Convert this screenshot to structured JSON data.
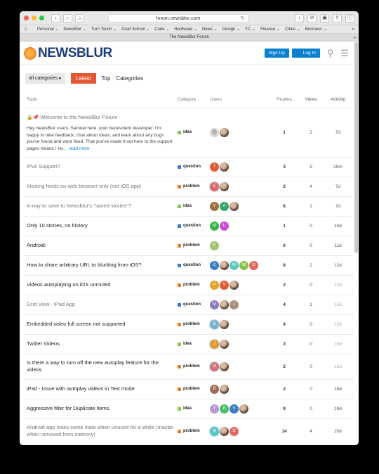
{
  "browser": {
    "url": "forum.newsblur.com",
    "tab_title": "The NewsBlur Forum",
    "bookmarks": [
      "Personal ⌄",
      "NewsBlur ⌄",
      "Turn Touch ⌄",
      "Grad School ⌄",
      "Code ⌄",
      "Hardware ⌄",
      "News ⌄",
      "Design ⌄",
      "YC ⌄",
      "Finance ⌄",
      "Cities ⌄",
      "Business ⌄"
    ],
    "overflow": "»"
  },
  "site": {
    "logo_text": "NEWSBLUR",
    "signup_label": "Sign Up",
    "login_label": "Log In"
  },
  "filters": {
    "categories_label": "all categories",
    "latest_label": "Latest",
    "top_label": "Top",
    "categories_link": "Categories"
  },
  "table": {
    "headers": {
      "topic": "Topic",
      "category": "Category",
      "users": "Users",
      "replies": "Replies",
      "views": "Views",
      "activity": "Activity"
    },
    "rows": [
      {
        "title": "Welcome to the NewsBlur Forum",
        "pinned": true,
        "visited": true,
        "excerpt": "Hey NewsBlur users, Samuel here, your benevolent developer. I'm happy to take feedback, chat about ideas, and learn about any bugs you've found and want fixed. That you've made it out here to the support pages means I ne…",
        "read_more": "read more",
        "category": "idea",
        "users": [
          {
            "t": "gear"
          },
          {
            "t": "photo"
          }
        ],
        "replies": "1",
        "views": "2",
        "activity": "7d"
      },
      {
        "title": "IPv6 Support?",
        "visited": true,
        "category": "question",
        "users": [
          {
            "l": "T",
            "c": "#e45735"
          },
          {
            "t": "photo"
          }
        ],
        "replies": "3",
        "views": "5",
        "activity": "25m"
      },
      {
        "title": "Missing feeds on web browser only (not iOS app)",
        "visited": true,
        "category": "problem",
        "users": [
          {
            "l": "E",
            "c": "#e06a5f",
            "ring": true
          },
          {
            "t": "photo"
          }
        ],
        "replies": "2",
        "views": "4",
        "activity": "7d"
      },
      {
        "title": "A way to save to Newsblur's \"saved stories\"?",
        "visited": true,
        "category": "idea",
        "users": [
          {
            "l": "V",
            "c": "#a0703a"
          },
          {
            "l": "A",
            "c": "#3aa56a"
          },
          {
            "t": "photo"
          }
        ],
        "replies": "6",
        "views": "2",
        "activity": "7d"
      },
      {
        "title": "Only 10 stories, no history",
        "category": "question",
        "users": [
          {
            "l": "M",
            "c": "#3ab54a"
          },
          {
            "l": "L",
            "c": "#c44fd0"
          }
        ],
        "replies": "1",
        "views": "0",
        "activity": "10d"
      },
      {
        "title": "Android:",
        "category": "problem",
        "users": [
          {
            "l": "S",
            "c": "#9ec66a"
          }
        ],
        "replies": "0",
        "views": "0",
        "activity": "11d"
      },
      {
        "title": "How to share arbitrary URL to blurblog from iOS?",
        "category": "question",
        "users": [
          {
            "l": "C",
            "c": "#3a7fc1"
          },
          {
            "t": "photo"
          },
          {
            "l": "M",
            "c": "#5ac8c0"
          },
          {
            "l": "W",
            "c": "#8bc34a"
          },
          {
            "l": "D",
            "c": "#e06a5f"
          }
        ],
        "replies": "8",
        "views": "2",
        "activity": "12d"
      },
      {
        "title": "Videos autoplaying on iOS unmuted",
        "category": "problem",
        "users": [
          {
            "l": "A",
            "c": "#e6a22a"
          },
          {
            "l": "N",
            "c": "#e45735"
          },
          {
            "t": "photo"
          }
        ],
        "replies": "2",
        "views": "0",
        "activity": "12d"
      },
      {
        "title": "Grid View - iPad App",
        "visited": true,
        "category": "question",
        "users": [
          {
            "l": "M",
            "c": "#8a7cc0"
          },
          {
            "t": "photo"
          },
          {
            "l": "J",
            "c": "#a8907c"
          }
        ],
        "replies": "4",
        "views": "1",
        "activity": "15d"
      },
      {
        "title": "Embedded video full screen not supported",
        "category": "problem",
        "users": [
          {
            "l": "B",
            "c": "#7cb0c8",
            "ring": true
          },
          {
            "t": "photo"
          }
        ],
        "replies": "4",
        "views": "0",
        "activity": "15d"
      },
      {
        "title": "Twitter Videos",
        "category": "idea",
        "users": [
          {
            "l": "J",
            "c": "#e69a2a",
            "ring": true
          },
          {
            "t": "photo"
          }
        ],
        "replies": "3",
        "views": "0",
        "activity": "15d"
      },
      {
        "title": "Is there a way to turn off the new autoplay feature for the videos",
        "category": "problem",
        "users": [
          {
            "l": "M",
            "c": "#d4707a",
            "ring": true
          },
          {
            "t": "photo"
          }
        ],
        "replies": "2",
        "views": "0",
        "activity": "15d"
      },
      {
        "title": "iPad - Issue with autoplay videos in Text mode",
        "category": "problem",
        "users": [
          {
            "l": "R",
            "c": "#a06b5a"
          },
          {
            "t": "photo"
          }
        ],
        "replies": "2",
        "views": "0",
        "activity": "16d"
      },
      {
        "title": "Aggressive filter for Duplicate items.",
        "category": "idea",
        "users": [
          {
            "l": "T",
            "c": "#b39ad8"
          },
          {
            "l": "E",
            "c": "#4cbf6a"
          },
          {
            "l": "V",
            "c": "#3a7fc1"
          },
          {
            "t": "photo"
          }
        ],
        "replies": "9",
        "views": "0",
        "activity": "19d"
      },
      {
        "title": "Android app loses some state when unused for a while (maybe when removed from memory)",
        "visited": true,
        "category": "problem",
        "users": [
          {
            "l": "M",
            "c": "#5ac8c0",
            "ring": true
          },
          {
            "t": "photo"
          },
          {
            "l": "D",
            "c": "#e06a5f"
          }
        ],
        "replies": "14",
        "views": "4",
        "activity": "20d"
      }
    ]
  },
  "colors": {
    "accent": "#e45735",
    "link": "#0881d1",
    "cat_idea": "#8bc34a",
    "cat_question": "#3a7fc1",
    "cat_problem": "#e67e22"
  }
}
